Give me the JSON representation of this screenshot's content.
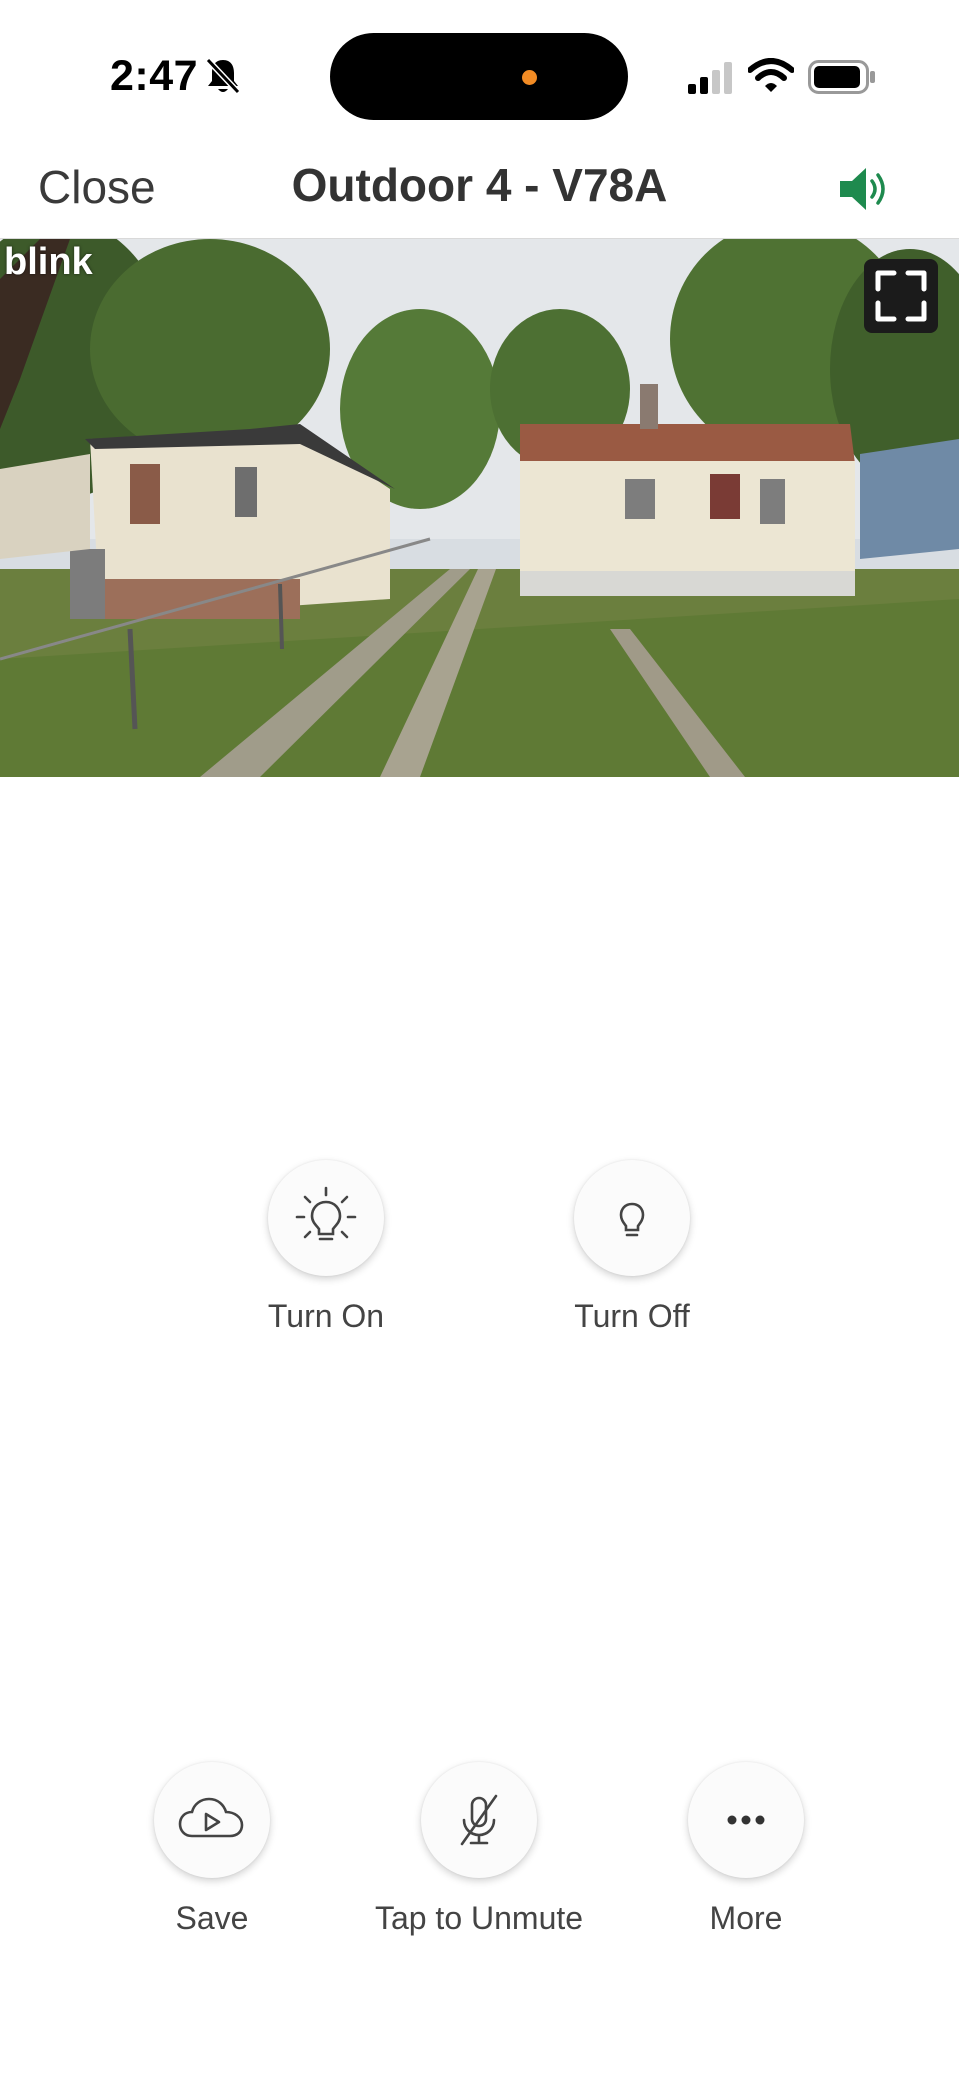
{
  "status_bar": {
    "time": "2:47",
    "icons": [
      "bell-slash-icon",
      "cellular-signal-icon",
      "wifi-icon",
      "battery-icon"
    ],
    "indicator_color": "#f28b24"
  },
  "nav": {
    "close_label": "Close",
    "title": "Outdoor 4 - V78A",
    "audio_icon": "speaker-on-icon",
    "accent_color": "#1e8a4e"
  },
  "feed": {
    "watermark": "blink",
    "fullscreen_icon": "fullscreen-icon"
  },
  "light_controls": {
    "turn_on_label": "Turn On",
    "turn_off_label": "Turn Off"
  },
  "bottom_actions": {
    "save_label": "Save",
    "unmute_label": "Tap to Unmute",
    "more_label": "More"
  }
}
